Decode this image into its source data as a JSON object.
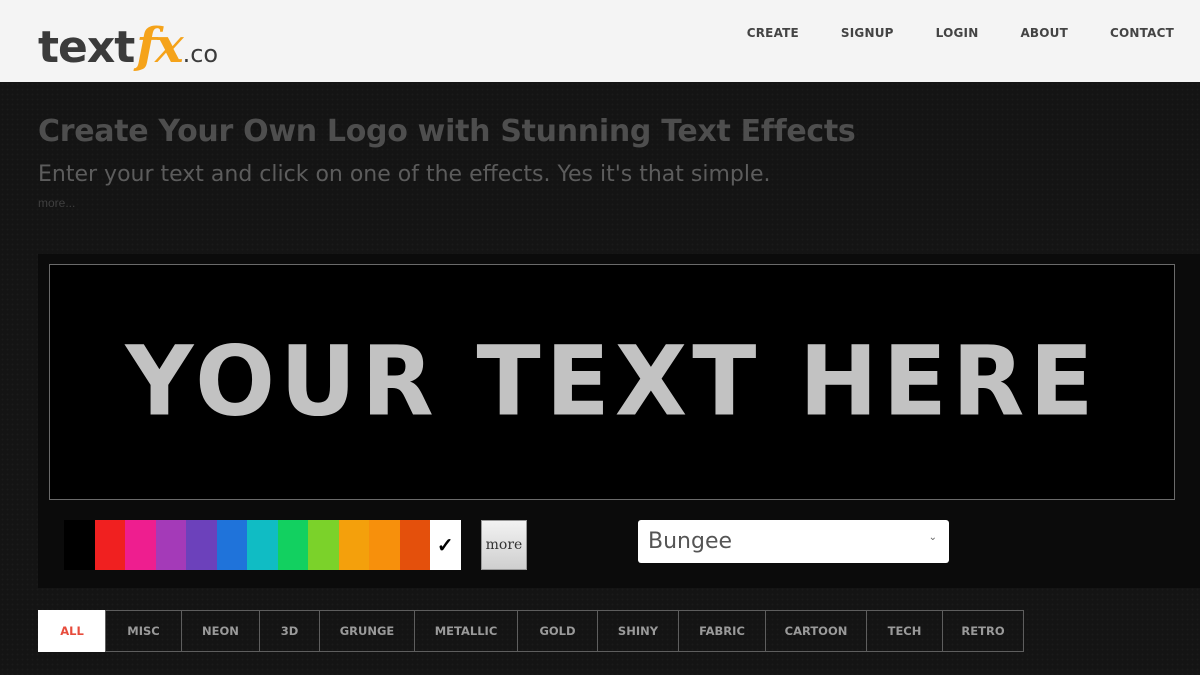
{
  "header": {
    "logo": {
      "text": "text",
      "fx": "fx",
      "co": ".co"
    },
    "nav": [
      "CREATE",
      "SIGNUP",
      "LOGIN",
      "ABOUT",
      "CONTACT"
    ]
  },
  "hero": {
    "title": "Create Your Own Logo with Stunning Text Effects",
    "subtitle": "Enter your text and click on one of the effects. Yes it's that simple.",
    "more": "more..."
  },
  "preview": {
    "text": "YOUR TEXT HERE"
  },
  "colors": {
    "swatches": [
      "#000000",
      "#f02020",
      "#ee1e8f",
      "#a43ab8",
      "#6c41bb",
      "#1f73da",
      "#10bcc4",
      "#12d060",
      "#7bd22a",
      "#f4a00c",
      "#f7900c",
      "#e4500c",
      "#ffffff"
    ],
    "selected_index": 12,
    "check_glyph": "✓"
  },
  "more_button": {
    "label": "more"
  },
  "font_select": {
    "value": "Bungee",
    "chevron": "⌄"
  },
  "categories": {
    "tabs": [
      "ALL",
      "MISC",
      "NEON",
      "3D",
      "GRUNGE",
      "METALLIC",
      "GOLD",
      "SHINY",
      "FABRIC",
      "CARTOON",
      "TECH",
      "RETRO"
    ],
    "active_index": 0
  }
}
